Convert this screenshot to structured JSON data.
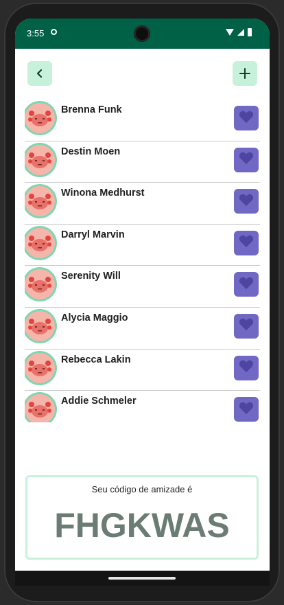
{
  "status_bar": {
    "time": "3:55"
  },
  "header": {
    "back_icon": "chevron-left-icon",
    "add_icon": "plus-icon"
  },
  "friends": [
    {
      "name": "Brenna Funk"
    },
    {
      "name": "Destin Moen"
    },
    {
      "name": "Winona Medhurst"
    },
    {
      "name": "Darryl Marvin"
    },
    {
      "name": "Serenity Will"
    },
    {
      "name": "Alycia Maggio"
    },
    {
      "name": "Rebecca Lakin"
    },
    {
      "name": "Addie Schmeler"
    }
  ],
  "friend_code": {
    "label": "Seu código de amizade é",
    "value": "FHGKWAS"
  },
  "colors": {
    "status_bar": "#006147",
    "accent_light": "#c8f1dc",
    "favorite": "#7068c4",
    "avatar_ring": "#7fd6b0",
    "code_text": "#6a7c73"
  }
}
